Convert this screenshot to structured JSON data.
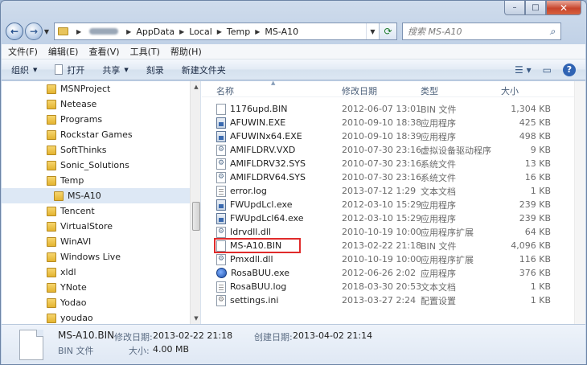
{
  "window": {
    "caption_min": "–",
    "caption_max": "□",
    "caption_close": "✕"
  },
  "address": {
    "crumbs": [
      "AppData",
      "Local",
      "Temp",
      "MS-A10"
    ],
    "search_placeholder": "搜索 MS-A10"
  },
  "menu": [
    "文件(F)",
    "编辑(E)",
    "查看(V)",
    "工具(T)",
    "帮助(H)"
  ],
  "toolbar": {
    "organize": "组织",
    "open": "打开",
    "share": "共享",
    "burn": "刻录",
    "new_folder": "新建文件夹"
  },
  "tree": [
    {
      "label": "MSNProject",
      "indent": 0,
      "selected": false
    },
    {
      "label": "Netease",
      "indent": 0,
      "selected": false
    },
    {
      "label": "Programs",
      "indent": 0,
      "selected": false
    },
    {
      "label": "Rockstar Games",
      "indent": 0,
      "selected": false
    },
    {
      "label": "SoftThinks",
      "indent": 0,
      "selected": false
    },
    {
      "label": "Sonic_Solutions",
      "indent": 0,
      "selected": false
    },
    {
      "label": "Temp",
      "indent": 0,
      "selected": false
    },
    {
      "label": "MS-A10",
      "indent": 1,
      "selected": true
    },
    {
      "label": "Tencent",
      "indent": 0,
      "selected": false
    },
    {
      "label": "VirtualStore",
      "indent": 0,
      "selected": false
    },
    {
      "label": "WinAVI",
      "indent": 0,
      "selected": false
    },
    {
      "label": "Windows Live",
      "indent": 0,
      "selected": false
    },
    {
      "label": "xldl",
      "indent": 0,
      "selected": false
    },
    {
      "label": "YNote",
      "indent": 0,
      "selected": false
    },
    {
      "label": "Yodao",
      "indent": 0,
      "selected": false
    },
    {
      "label": "youdao",
      "indent": 0,
      "selected": false
    }
  ],
  "columns": {
    "name": "名称",
    "date": "修改日期",
    "type": "类型",
    "size": "大小"
  },
  "files": [
    {
      "name": "1176upd.BIN",
      "date": "2012-06-07 13:01",
      "type": "BIN 文件",
      "size": "1,304 KB",
      "icon": "bin"
    },
    {
      "name": "AFUWIN.EXE",
      "date": "2010-09-10 18:38",
      "type": "应用程序",
      "size": "425 KB",
      "icon": "exe"
    },
    {
      "name": "AFUWINx64.EXE",
      "date": "2010-09-10 18:39",
      "type": "应用程序",
      "size": "498 KB",
      "icon": "exe"
    },
    {
      "name": "AMIFLDRV.VXD",
      "date": "2010-07-30 23:16",
      "type": "虚拟设备驱动程序",
      "size": "9 KB",
      "icon": "sys"
    },
    {
      "name": "AMIFLDRV32.SYS",
      "date": "2010-07-30 23:16",
      "type": "系统文件",
      "size": "13 KB",
      "icon": "sys"
    },
    {
      "name": "AMIFLDRV64.SYS",
      "date": "2010-07-30 23:16",
      "type": "系统文件",
      "size": "16 KB",
      "icon": "sys"
    },
    {
      "name": "error.log",
      "date": "2013-07-12 1:29",
      "type": "文本文档",
      "size": "1 KB",
      "icon": "log"
    },
    {
      "name": "FWUpdLcl.exe",
      "date": "2012-03-10 15:29",
      "type": "应用程序",
      "size": "239 KB",
      "icon": "exe"
    },
    {
      "name": "FWUpdLcl64.exe",
      "date": "2012-03-10 15:29",
      "type": "应用程序",
      "size": "239 KB",
      "icon": "exe"
    },
    {
      "name": "Idrvdll.dll",
      "date": "2010-10-19 10:00",
      "type": "应用程序扩展",
      "size": "64 KB",
      "icon": "dll"
    },
    {
      "name": "MS-A10.BIN",
      "date": "2013-02-22 21:18",
      "type": "BIN 文件",
      "size": "4,096 KB",
      "icon": "bin"
    },
    {
      "name": "Pmxdll.dll",
      "date": "2010-10-19 10:00",
      "type": "应用程序扩展",
      "size": "116 KB",
      "icon": "dll"
    },
    {
      "name": "RosaBUU.exe",
      "date": "2012-06-26 2:02",
      "type": "应用程序",
      "size": "376 KB",
      "icon": "app-blue"
    },
    {
      "name": "RosaBUU.log",
      "date": "2018-03-30 20:53",
      "type": "文本文档",
      "size": "1 KB",
      "icon": "log"
    },
    {
      "name": "settings.ini",
      "date": "2013-03-27 2:24",
      "type": "配置设置",
      "size": "1 KB",
      "icon": "ini"
    }
  ],
  "details": {
    "name": "MS-A10.BIN",
    "modified_label": "修改日期:",
    "modified_value": "2013-02-22 21:18",
    "created_label": "创建日期:",
    "created_value": "2013-04-02 21:14",
    "type": "BIN 文件",
    "size_label": "大小:",
    "size_value": "4.00 MB"
  },
  "colors": {
    "highlight_box": "#e02b2b",
    "selected_tree": "#dde8f5"
  }
}
